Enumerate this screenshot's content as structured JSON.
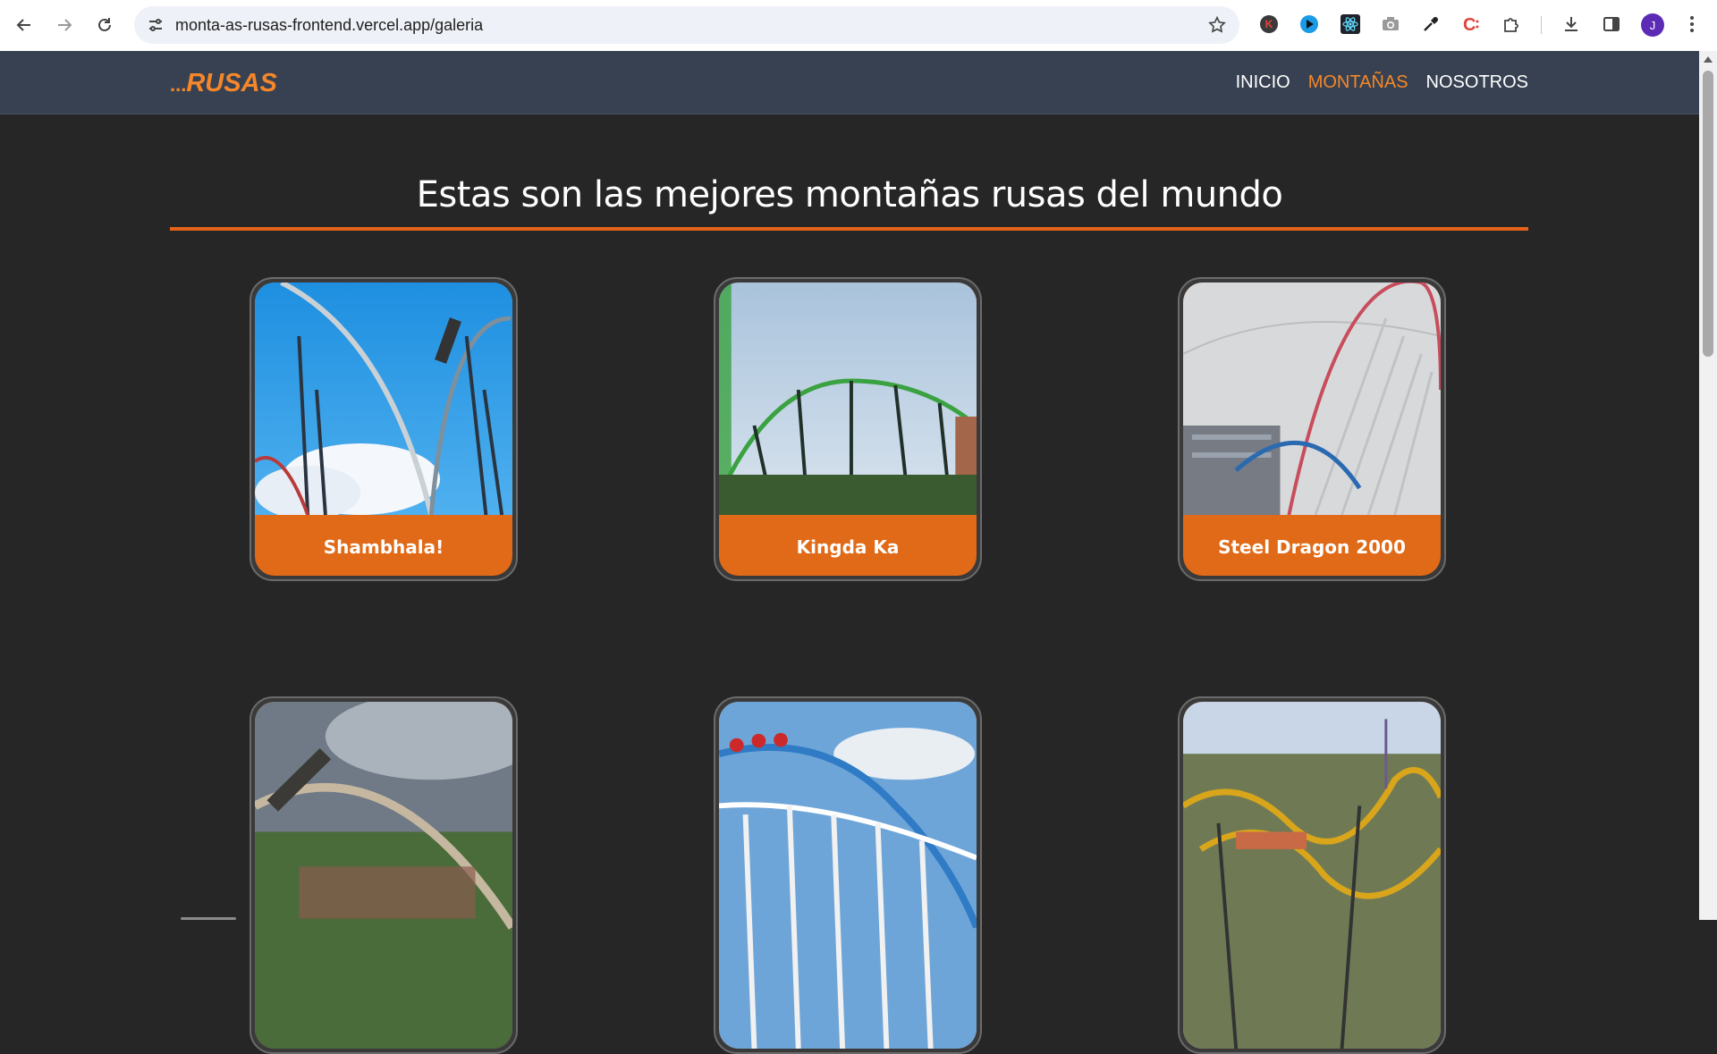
{
  "browser": {
    "url": "monta-as-rusas-frontend.vercel.app/galeria",
    "back_icon": "arrow-left-icon",
    "forward_icon": "arrow-right-icon",
    "reload_icon": "reload-icon",
    "profile_initial": "J",
    "extensions": [
      "k-extension-icon",
      "video-extension-icon",
      "react-devtools-icon",
      "camera-icon",
      "eyedropper-icon",
      "c-extension-icon",
      "puzzle-icon"
    ]
  },
  "header": {
    "logo_dots": "...",
    "logo_text": "RUSAS",
    "nav": [
      {
        "label": "INICIO",
        "active": false
      },
      {
        "label": "MONTAÑAS",
        "active": true
      },
      {
        "label": "NOSOTROS",
        "active": false
      }
    ]
  },
  "main": {
    "title": "Estas son las mejores montañas rusas del mundo",
    "cards": [
      {
        "name": "Shambhala!"
      },
      {
        "name": "Kingda Ka"
      },
      {
        "name": "Steel Dragon 2000"
      }
    ]
  },
  "colors": {
    "accent": "#f5872a",
    "card_label_bg": "#e06a17",
    "header_bg": "#374151",
    "page_bg": "#262626"
  }
}
